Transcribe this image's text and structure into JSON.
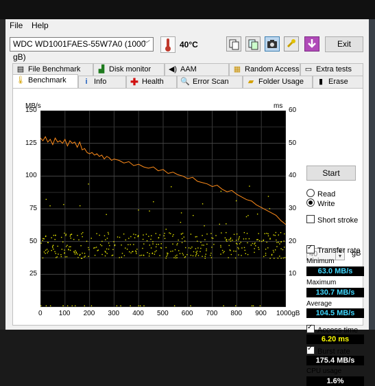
{
  "menu": {
    "file": "File",
    "help": "Help"
  },
  "drive": {
    "selected": "WDC WD1001FAES-55W7A0 (1000 gB)"
  },
  "temperature": "40°C",
  "exit_label": "Exit",
  "tabs_top": [
    {
      "label": "File Benchmark",
      "icon": "file-benchmark-icon"
    },
    {
      "label": "Disk monitor",
      "icon": "disk-monitor-icon"
    },
    {
      "label": "AAM",
      "icon": "speaker-icon"
    },
    {
      "label": "Random Access",
      "icon": "random-access-icon"
    },
    {
      "label": "Extra tests",
      "icon": "extra-tests-icon"
    }
  ],
  "tabs_bottom": [
    {
      "label": "Benchmark",
      "icon": "benchmark-icon"
    },
    {
      "label": "Info",
      "icon": "info-icon"
    },
    {
      "label": "Health",
      "icon": "health-icon"
    },
    {
      "label": "Error Scan",
      "icon": "error-scan-icon"
    },
    {
      "label": "Folder Usage",
      "icon": "folder-icon"
    },
    {
      "label": "Erase",
      "icon": "erase-icon"
    }
  ],
  "controls": {
    "start": "Start",
    "read": "Read",
    "write": "Write",
    "mode": "write",
    "short_stroke": "Short stroke",
    "short_stroke_checked": false,
    "stroke_value": "40",
    "stroke_unit": "gB",
    "transfer_rate": "Transfer rate",
    "transfer_rate_checked": true,
    "access_time": "Access time",
    "access_time_checked": true,
    "burst_rate": "Burst rate",
    "burst_rate_checked": true
  },
  "stats": {
    "minimum_label": "Minimum",
    "minimum": "63.0 MB/s",
    "maximum_label": "Maximum",
    "maximum": "130.7 MB/s",
    "average_label": "Average",
    "average": "104.5 MB/s",
    "access_time": "6.20 ms",
    "burst_rate": "175.4 MB/s",
    "cpu_label": "CPU usage",
    "cpu": "1.6%"
  },
  "colors": {
    "transfer": "#ff8c1a",
    "access": "#e6e600",
    "plot_bg": "#000000"
  },
  "chart_data": {
    "type": "line",
    "ylabel": "MB/s",
    "y2label": "ms",
    "xlim": [
      0,
      1000
    ],
    "ylim": [
      0,
      150
    ],
    "y2lim": [
      0,
      60
    ],
    "x_ticks": [
      "0",
      "100",
      "200",
      "300",
      "400",
      "500",
      "600",
      "700",
      "800",
      "900",
      "1000gB"
    ],
    "y_ticks": [
      "150",
      "125",
      "100",
      "75",
      "50",
      "25"
    ],
    "y2_ticks": [
      "60",
      "50",
      "40",
      "30",
      "20",
      "10"
    ],
    "series": [
      {
        "x": [
          0,
          10,
          20,
          30,
          40,
          50,
          60,
          70,
          80,
          90,
          100,
          110,
          120,
          130,
          140,
          150,
          160,
          170,
          180,
          190,
          200,
          210,
          220,
          230,
          240,
          250,
          260,
          270,
          280,
          290,
          300,
          320,
          340,
          360,
          380,
          400,
          420,
          440,
          460,
          480,
          500,
          520,
          540,
          560,
          580,
          600,
          620,
          640,
          660,
          680,
          700,
          720,
          740,
          760,
          780,
          800,
          820,
          840,
          860,
          880,
          900,
          920,
          940,
          960,
          980,
          1000
        ],
        "y": [
          129,
          127,
          130,
          126,
          128,
          124,
          129,
          126,
          127,
          125,
          128,
          123,
          127,
          125,
          126,
          122,
          126,
          120,
          121,
          118,
          117,
          118,
          116,
          117,
          115,
          116,
          113,
          115,
          114,
          112,
          113,
          112,
          110,
          111,
          108,
          109,
          107,
          106,
          107,
          104,
          105,
          102,
          103,
          101,
          100,
          98,
          99,
          96,
          95,
          94,
          92,
          93,
          90,
          88,
          89,
          86,
          84,
          82,
          81,
          78,
          76,
          74,
          72,
          70,
          66,
          63
        ]
      }
    ],
    "access_time_ms": {
      "typical_min": 15,
      "typical_max": 23,
      "outliers_max": 38
    }
  }
}
